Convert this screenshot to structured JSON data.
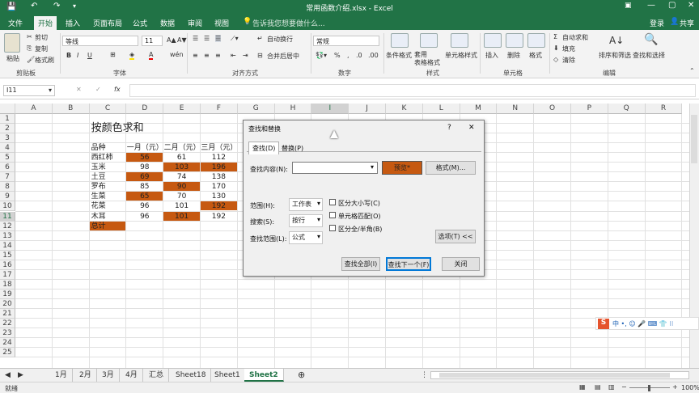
{
  "titlebar": {
    "title": "常用函数介绍.xlsx - Excel",
    "user_label": "登录",
    "share_label": "共享"
  },
  "ribbon_tabs": [
    "文件",
    "开始",
    "插入",
    "页面布局",
    "公式",
    "数据",
    "审阅",
    "视图"
  ],
  "active_tab": "开始",
  "tell_me": "告诉我您想要做什么...",
  "clipboard": {
    "paste": "粘贴",
    "cut": "剪切",
    "copy": "复制",
    "format_painter": "格式刷",
    "group": "剪贴板"
  },
  "font": {
    "name": "等线",
    "size": "11",
    "bold": "B",
    "italic": "I",
    "underline": "U",
    "group": "字体"
  },
  "alignment": {
    "wrap": "自动换行",
    "merge": "合并后居中",
    "group": "对齐方式"
  },
  "number": {
    "format": "常规",
    "percent": "%",
    "comma": ",",
    "group": "数字"
  },
  "styles": {
    "conditional": "条件格式",
    "table": "套用\n表格格式",
    "cell_styles": "单元格样式",
    "group": "样式"
  },
  "cells": {
    "insert": "插入",
    "delete": "删除",
    "format": "格式",
    "group": "单元格"
  },
  "editing": {
    "autosum": "自动求和",
    "fill": "填充",
    "clear": "清除",
    "sort": "排序和筛选",
    "find": "查找和选择",
    "group": "编辑"
  },
  "formula_bar": {
    "name_box": "I11",
    "fx": "fx",
    "value": ""
  },
  "columns": [
    "A",
    "B",
    "C",
    "D",
    "E",
    "F",
    "G",
    "H",
    "I",
    "J",
    "K",
    "L",
    "M",
    "N",
    "O",
    "P",
    "Q",
    "R"
  ],
  "rows": [
    "1",
    "2",
    "3",
    "4",
    "5",
    "6",
    "7",
    "8",
    "9",
    "10",
    "11",
    "12",
    "13",
    "14",
    "15",
    "16",
    "17",
    "18",
    "19",
    "20",
    "21",
    "22",
    "23",
    "24",
    "25"
  ],
  "sheet": {
    "title": "按颜色求和",
    "headers": [
      "品种",
      "一月（元）",
      "二月（元）",
      "三月（元）"
    ],
    "data": [
      [
        "西红柿",
        "56",
        "61",
        "112"
      ],
      [
        "玉米",
        "98",
        "103",
        "196"
      ],
      [
        "土豆",
        "69",
        "74",
        "138"
      ],
      [
        "罗布",
        "85",
        "90",
        "170"
      ],
      [
        "生菜",
        "65",
        "70",
        "130"
      ],
      [
        "花菜",
        "96",
        "101",
        "192"
      ],
      [
        "木耳",
        "96",
        "101",
        "192"
      ]
    ],
    "total_label": "总计"
  },
  "dialog": {
    "title": "查找和替换",
    "help": "?",
    "close": "✕",
    "tab_find": "查找(D)",
    "tab_replace": "替换(P)",
    "find_what_label": "查找内容(N):",
    "preview": "预览*",
    "format": "格式(M)...",
    "within_label": "范围(H):",
    "within_value": "工作表",
    "search_label": "搜索(S):",
    "search_value": "按行",
    "look_in_label": "查找范围(L):",
    "look_in_value": "公式",
    "match_case": "区分大小写(C)",
    "match_entire": "单元格匹配(O)",
    "match_width": "区分全/半角(B)",
    "options": "选项(T) <<",
    "find_all": "查找全部(I)",
    "find_next": "查找下一个(F)",
    "close_btn": "关闭"
  },
  "sheet_tabs": [
    "1月",
    "2月",
    "3月",
    "4月",
    "汇总",
    "Sheet18",
    "Sheet1",
    "Sheet2"
  ],
  "active_sheet": "Sheet2",
  "status": {
    "ready": "就绪",
    "zoom": "100%"
  },
  "colors": {
    "excel_green": "#217346",
    "highlight": "#c65911"
  }
}
